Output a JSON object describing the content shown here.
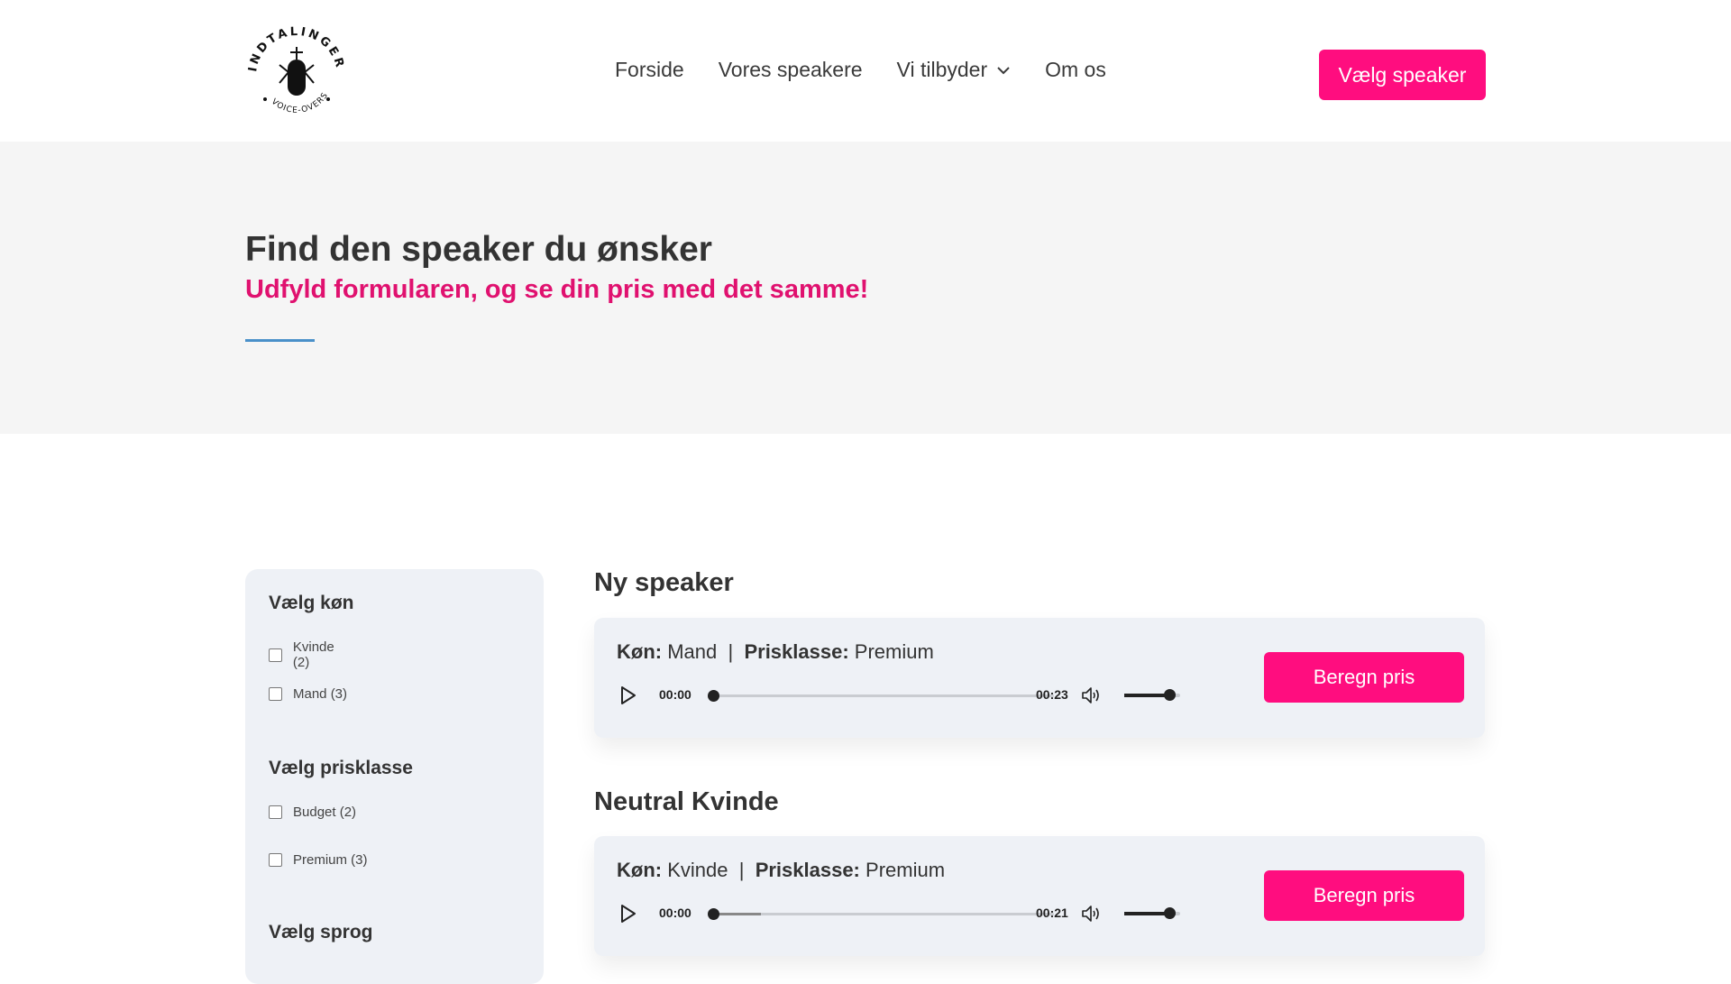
{
  "header": {
    "logo_top_text": "INDTALINGER",
    "logo_bottom_text": "VOICE-OVERS",
    "nav": [
      {
        "label": "Forside"
      },
      {
        "label": "Vores speakere"
      },
      {
        "label": "Vi tilbyder",
        "icon": "chevron-down-icon"
      },
      {
        "label": "Om os"
      }
    ],
    "cta_label": "Vælg speaker"
  },
  "hero": {
    "title": "Find den speaker du ønsker",
    "subtitle": "Udfyld formularen, og se din pris med det samme!"
  },
  "filters": {
    "gender": {
      "title": "Vælg køn",
      "options": [
        {
          "label": "Kvinde (2)",
          "checked": false
        },
        {
          "label": "Mand (3)",
          "checked": false
        }
      ]
    },
    "price_class": {
      "title": "Vælg prisklasse",
      "options": [
        {
          "label": "Budget (2)",
          "checked": false
        },
        {
          "label": "Premium (3)",
          "checked": false
        }
      ]
    },
    "language": {
      "title": "Vælg sprog"
    }
  },
  "speakers": [
    {
      "name": "Ny speaker",
      "gender_label": "Køn:",
      "gender": "Mand",
      "separator": "|",
      "price_label": "Prisklasse:",
      "price_class": "Premium",
      "current_time": "00:00",
      "duration": "00:23",
      "buffered_fraction": 0.0,
      "button_label": "Beregn pris"
    },
    {
      "name": "Neutral Kvinde",
      "gender_label": "Køn:",
      "gender": "Kvinde",
      "separator": "|",
      "price_label": "Prisklasse:",
      "price_class": "Premium",
      "current_time": "00:00",
      "duration": "00:21",
      "buffered_fraction": 0.15,
      "button_label": "Beregn pris"
    }
  ],
  "colors": {
    "accent": "#ff0d7f",
    "subtitle": "#e0116f",
    "divider": "#4a90c9",
    "hero_bg": "#f5f5f5",
    "card_bg": "#eef1f6"
  }
}
